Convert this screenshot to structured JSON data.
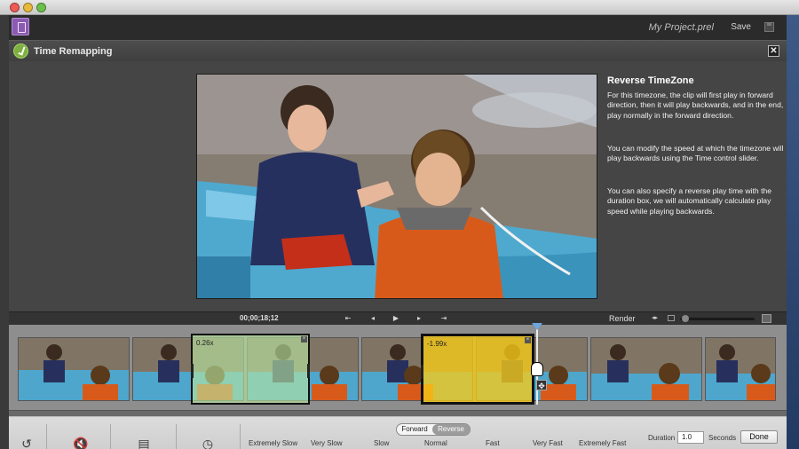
{
  "app": {
    "project_title": "My Project.prel",
    "save_label": "Save"
  },
  "panel": {
    "title": "Time Remapping"
  },
  "info": {
    "title": "Reverse TimeZone",
    "paragraphs": [
      "For this timezone, the clip will first play in forward direction, then it will play backwards, and in the end, play normally in the forward direction.",
      "You can modify the speed at which the timezone will play backwards using the Time control slider.",
      "You can also specify a reverse play time with the duration box, we will automatically calculate play speed while playing backwards."
    ]
  },
  "transport": {
    "timecode": "00;00;18;12",
    "render_label": "Render",
    "zoom_level": 0.03
  },
  "timeline": {
    "timezones": [
      {
        "speed_label": "0.26x",
        "color": "#bde8a4"
      },
      {
        "speed_label": "-1.99x",
        "color": "#f8cc16"
      }
    ]
  },
  "direction_toggle": {
    "forward": "Forward",
    "reverse": "Reverse",
    "selected": "Reverse"
  },
  "speed_scale": [
    "Extremely Slow",
    "Very Slow",
    "Slow",
    "Normal",
    "Fast",
    "Very Fast",
    "Extremely Fast"
  ],
  "duration": {
    "label": "Duration",
    "value": "1.0",
    "unit": "Seconds"
  },
  "done_label": "Done",
  "icons": {
    "app_logo": "organizer-icon",
    "panel": "time-remapping-icon",
    "close": "close-icon",
    "disk": "disk-icon",
    "undo": "undo-icon",
    "mute": "mute-icon",
    "film": "film-icon",
    "clock": "clock-icon"
  }
}
